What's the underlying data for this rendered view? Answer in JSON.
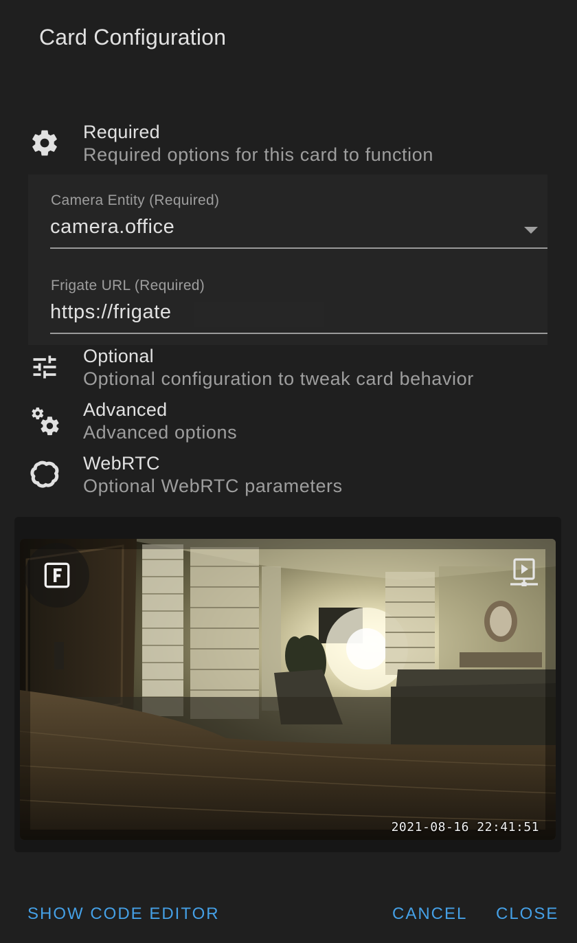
{
  "dialog": {
    "title": "Card Configuration"
  },
  "sections": {
    "required": {
      "icon": "gear-icon",
      "title": "Required",
      "subtitle": "Required options for this card to function"
    },
    "optional": {
      "icon": "tune-icon",
      "title": "Optional",
      "subtitle": "Optional configuration to tweak card behavior"
    },
    "advanced": {
      "icon": "cogs-icon",
      "title": "Advanced",
      "subtitle": "Advanced options"
    },
    "webrtc": {
      "icon": "webrtc-icon",
      "title": "WebRTC",
      "subtitle": "Optional WebRTC parameters"
    }
  },
  "fields": {
    "camera_entity": {
      "label": "Camera Entity (Required)",
      "value": "camera.office"
    },
    "frigate_url": {
      "label": "Frigate URL (Required)",
      "value": "https://frigate"
    }
  },
  "preview": {
    "timestamp": "2021-08-16 22:41:51",
    "frigate_button_icon": "frigate-f-icon",
    "live_button_icon": "live-view-icon"
  },
  "actions": {
    "show_code_editor": "SHOW CODE EDITOR",
    "cancel": "CANCEL",
    "close": "CLOSE"
  },
  "colors": {
    "background": "#1f1f1f",
    "accent": "#45a0e6",
    "text_primary": "#e1e1e1",
    "text_secondary": "#9e9e9e"
  }
}
